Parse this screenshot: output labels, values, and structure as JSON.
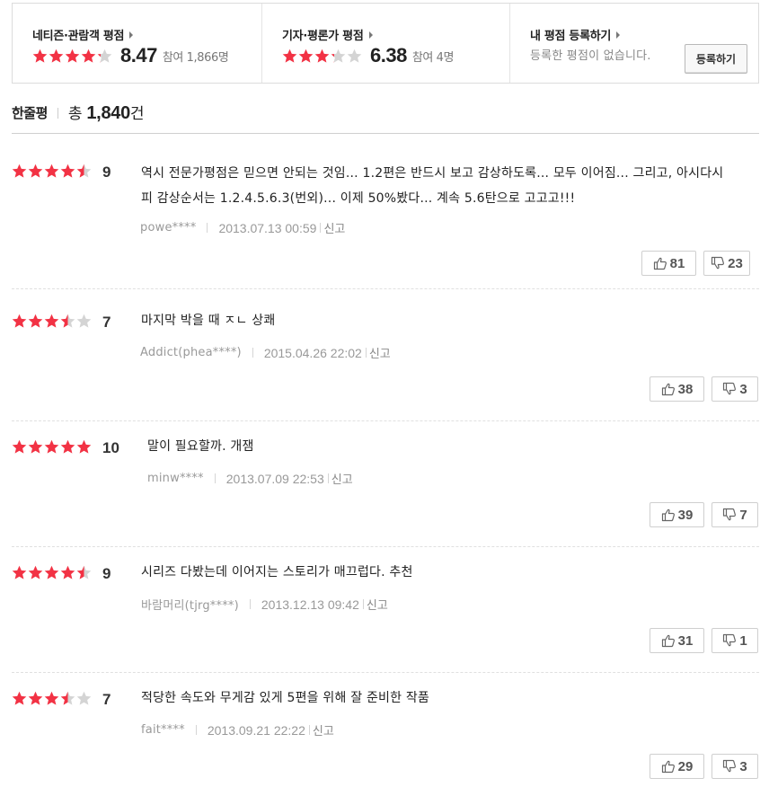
{
  "summary": {
    "netizen": {
      "title": "네티즌·관람객 평점",
      "score": "8.47",
      "count": "참여 1,866명",
      "stars": 4.2
    },
    "critic": {
      "title": "기자·평론가 평점",
      "score": "6.38",
      "count": "참여 4명",
      "stars": 3.2
    },
    "mine": {
      "title": "내 평점 등록하기",
      "empty_text": "등록한 평점이 없습니다.",
      "button_label": "등록하기"
    }
  },
  "heading": {
    "title": "한줄평",
    "total_prefix": "총 ",
    "total_count": "1,840",
    "total_suffix": "건"
  },
  "colors": {
    "star_on": "#f23244",
    "star_off": "#d4d4d4",
    "text_dark": "#222222",
    "text_muted": "#999999"
  },
  "icons": {
    "upvote": "thumbs-up-icon",
    "downvote": "thumbs-down-icon",
    "arrow": "arrow-right-icon"
  },
  "reviews": [
    {
      "stars": 4.5,
      "score": "9",
      "text": "역시 전문가평점은 믿으면 안되는 것임... 1.2편은 반드시 보고 감상하도록... 모두 이어짐... 그리고, 아시다시피 감상순서는 1.2.4.5.6.3(번외)... 이제 50%봤다... 계속 5.6탄으로 고고고!!!",
      "user": "powe****",
      "date": "2013.07.13 00:59",
      "report": "신고",
      "up": "81",
      "down": "23"
    },
    {
      "stars": 3.5,
      "score": "7",
      "text": "마지막 박을 때 ㅈㄴ 상쾌",
      "user": "Addict(phea****)",
      "date": "2015.04.26 22:02",
      "report": "신고",
      "up": "38",
      "down": "3"
    },
    {
      "stars": 5,
      "score": "10",
      "text": "말이 필요할까. 개잼",
      "user": "minw****",
      "date": "2013.07.09 22:53",
      "report": "신고",
      "up": "39",
      "down": "7"
    },
    {
      "stars": 4.5,
      "score": "9",
      "text": "시리즈 다봤는데 이어지는 스토리가 매끄럽다. 추천",
      "user": "바람머리(tjrg****)",
      "date": "2013.12.13 09:42",
      "report": "신고",
      "up": "31",
      "down": "1"
    },
    {
      "stars": 3.5,
      "score": "7",
      "text": "적당한 속도와 무게감 있게 5편을 위해 잘 준비한 작품",
      "user": "fait****",
      "date": "2013.09.21 22:22",
      "report": "신고",
      "up": "29",
      "down": "3"
    }
  ]
}
